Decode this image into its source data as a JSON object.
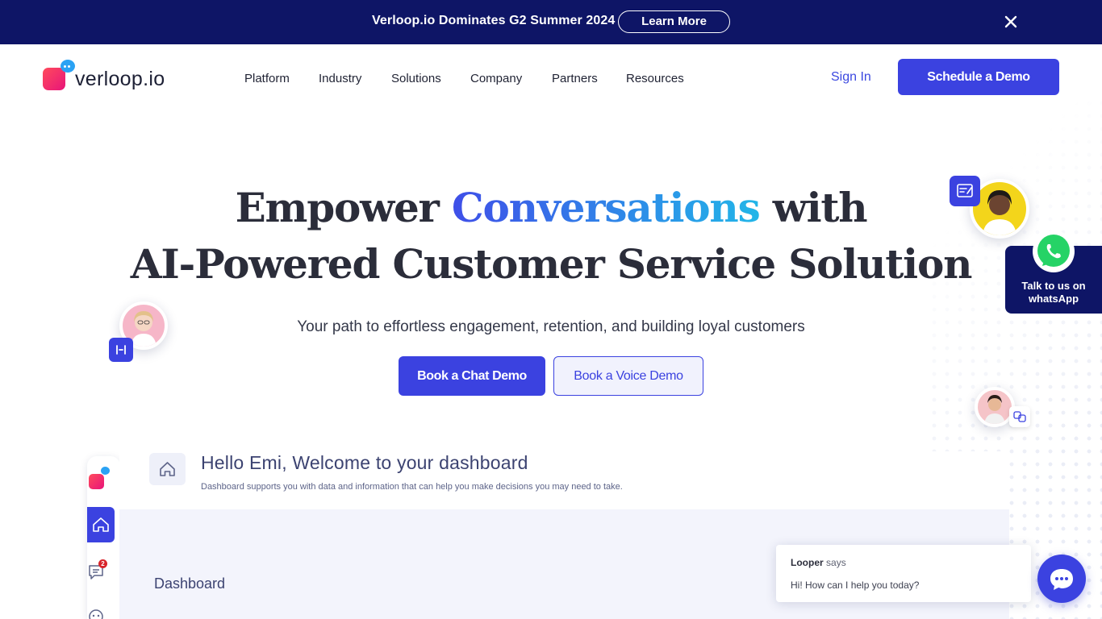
{
  "announcement": {
    "text": "Verloop.io Dominates G2 Summer 2024",
    "button_label": "Learn More"
  },
  "brand": {
    "name": "verloop.io"
  },
  "nav": {
    "items": [
      "Platform",
      "Industry",
      "Solutions",
      "Company",
      "Partners",
      "Resources"
    ],
    "sign_in": "Sign In",
    "cta": "Schedule a Demo"
  },
  "hero": {
    "line1_before": "Empower",
    "line1_accent": "Conversations",
    "line1_after": "with",
    "line2": "AI-Powered Customer Service Solution",
    "subtitle": "Your path to effortless engagement, retention, and building loyal customers",
    "primary_cta": "Book a Chat Demo",
    "secondary_cta": "Book a Voice Demo"
  },
  "whatsapp": {
    "label": "Talk to us on whatsApp"
  },
  "dashboard": {
    "greeting": "Hello Emi, Welcome to your dashboard",
    "description": "Dashboard supports you with data and information that can help you make decisions you may need to take.",
    "section_title": "Dashboard",
    "notification_count": "2"
  },
  "chat_widget": {
    "agent_name": "Looper",
    "says": "says",
    "message": "Hi! How can I help you today?"
  },
  "colors": {
    "navy": "#0e1566",
    "primary": "#3b42e0",
    "accent_start": "#3f4fe8",
    "accent_end": "#22b6e8"
  }
}
